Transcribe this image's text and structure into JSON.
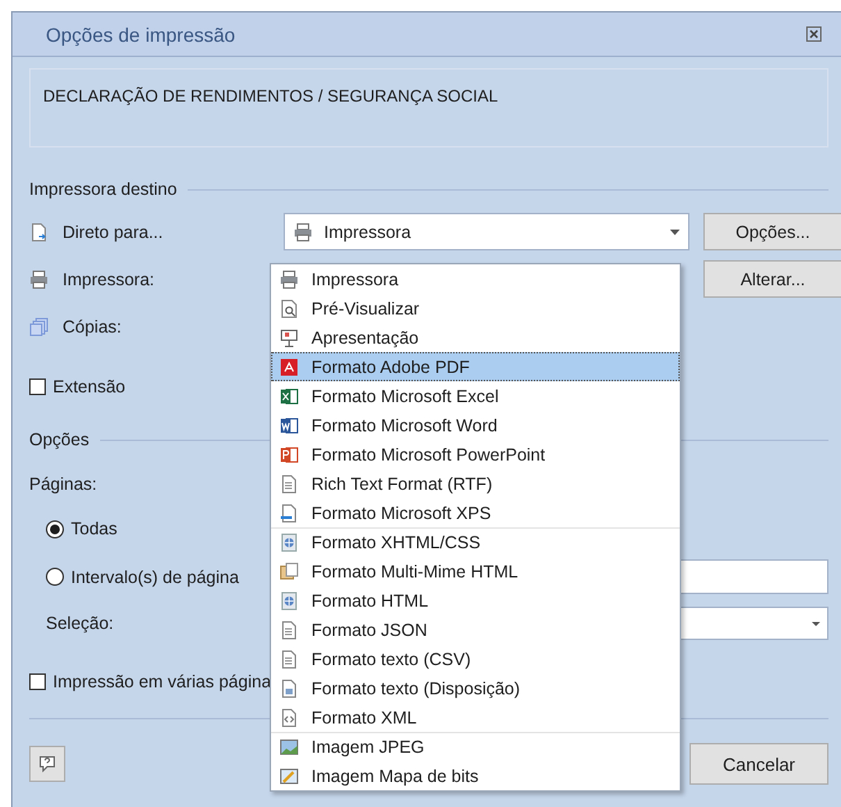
{
  "window": {
    "title": "Opções de impressão"
  },
  "description": "DECLARAÇÃO DE RENDIMENTOS / SEGURANÇA SOCIAL",
  "printer_section": {
    "heading": "Impressora destino",
    "rows": [
      {
        "kind": "direct",
        "label": "Direto para...",
        "value": "Impressora",
        "button": "Opções..."
      },
      {
        "kind": "printer",
        "label": "Impressora:",
        "button": "Alterar..."
      },
      {
        "kind": "copies",
        "label": "Cópias:"
      }
    ],
    "extension": {
      "label": "Extensão",
      "checked": false
    }
  },
  "options_section": {
    "heading": "Opções",
    "pages_label": "Páginas:",
    "radios": [
      {
        "label": "Todas",
        "selected": true
      },
      {
        "label": "Intervalo(s) de página",
        "selected": false
      }
    ],
    "selection_label": "Seleção:",
    "multi_page": {
      "label": "Impressão em várias página",
      "checked": false
    }
  },
  "footer": {
    "cancel": "Cancelar"
  },
  "dropdown": {
    "items": [
      {
        "kind": "printer",
        "label": "Impressora",
        "selected": false
      },
      {
        "kind": "preview",
        "label": "Pré-Visualizar",
        "selected": false
      },
      {
        "kind": "presentation",
        "label": "Apresentação",
        "selected": false
      },
      {
        "kind": "pdf",
        "label": "Formato Adobe PDF",
        "selected": true
      },
      {
        "kind": "excel",
        "label": "Formato Microsoft Excel",
        "selected": false
      },
      {
        "kind": "word",
        "label": "Formato Microsoft Word",
        "selected": false
      },
      {
        "kind": "powerpoint",
        "label": "Formato Microsoft PowerPoint",
        "selected": false
      },
      {
        "kind": "document",
        "label": "Rich Text Format (RTF)",
        "selected": false
      },
      {
        "kind": "xps",
        "label": "Formato Microsoft XPS",
        "selected": false
      },
      {
        "kind": "web",
        "label": "Formato XHTML/CSS",
        "selected": false
      },
      {
        "kind": "mime",
        "label": "Formato Multi-Mime HTML",
        "selected": false
      },
      {
        "kind": "web",
        "label": "Formato HTML",
        "selected": false
      },
      {
        "kind": "document",
        "label": "Formato JSON",
        "selected": false
      },
      {
        "kind": "document",
        "label": "Formato texto (CSV)",
        "selected": false
      },
      {
        "kind": "layout",
        "label": "Formato texto (Disposição)",
        "selected": false
      },
      {
        "kind": "xml",
        "label": "Formato XML",
        "selected": false
      },
      {
        "kind": "image",
        "label": "Imagem JPEG",
        "selected": false
      },
      {
        "kind": "bitmap",
        "label": "Imagem Mapa de bits",
        "selected": false
      }
    ]
  }
}
